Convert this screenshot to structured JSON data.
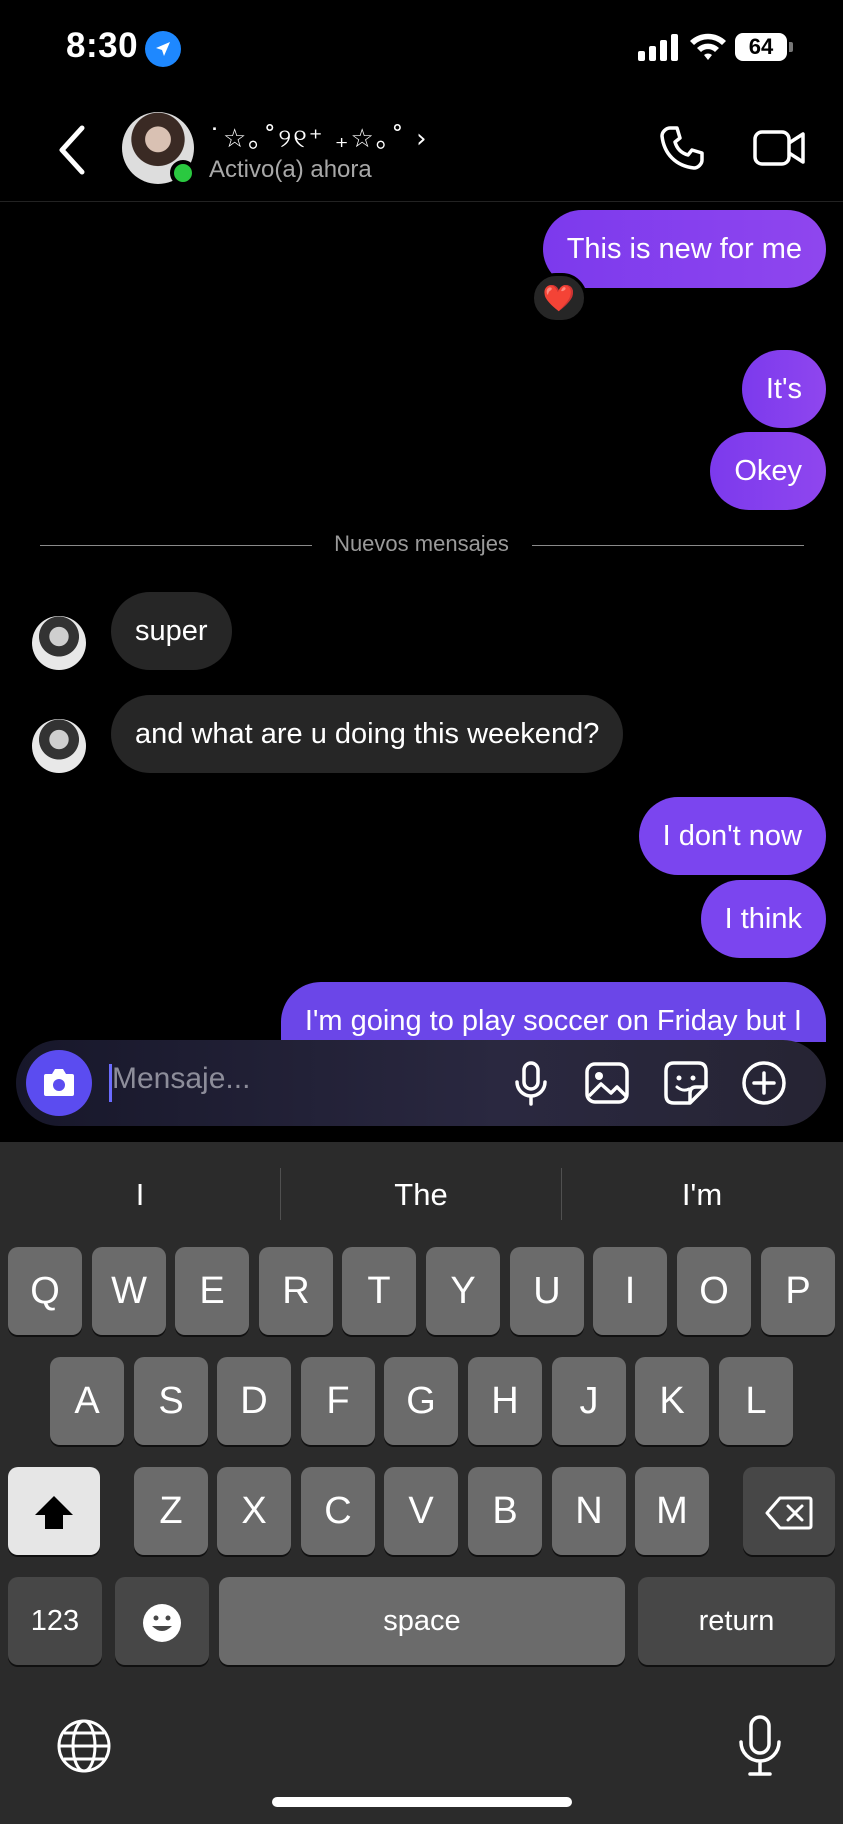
{
  "status_bar": {
    "time": "8:30",
    "battery": "64"
  },
  "header": {
    "contact_name": "˙☆｡˚୨୧⁺ ₊☆｡˚",
    "chevron": "›",
    "status": "Activo(a) ahora"
  },
  "messages": [
    {
      "dir": "out",
      "text": "This is new for me"
    },
    {
      "dir": "out",
      "text": "It's"
    },
    {
      "dir": "out",
      "text": "Okey"
    },
    {
      "dir": "in",
      "text": "super"
    },
    {
      "dir": "in",
      "text": "and what are u doing this weekend?"
    },
    {
      "dir": "out",
      "text": "I don't now"
    },
    {
      "dir": "out",
      "text": "I think"
    },
    {
      "dir": "out",
      "text": "I'm going to play soccer on Friday but I"
    }
  ],
  "reaction": "❤️",
  "divider_label": "Nuevos mensajes",
  "composer": {
    "placeholder": "Mensaje..."
  },
  "suggestions": [
    "I",
    "The",
    "I'm"
  ],
  "keyboard": {
    "row1": [
      "Q",
      "W",
      "E",
      "R",
      "T",
      "Y",
      "U",
      "I",
      "O",
      "P"
    ],
    "row2": [
      "A",
      "S",
      "D",
      "F",
      "G",
      "H",
      "J",
      "K",
      "L"
    ],
    "row3": [
      "Z",
      "X",
      "C",
      "V",
      "B",
      "N",
      "M"
    ],
    "numbers_label": "123",
    "space_label": "space",
    "return_label": "return"
  },
  "icons": {
    "back": "chevron-left-icon",
    "call": "phone-icon",
    "video": "video-camera-icon",
    "camera": "camera-icon",
    "mic": "microphone-icon",
    "gallery": "image-icon",
    "sticker": "sticker-icon",
    "plus": "plus-circle-icon",
    "globe": "globe-icon",
    "dictation": "microphone-icon"
  },
  "colors": {
    "accent_purple": "#7c3aed",
    "online": "#2ac940",
    "incoming_bubble": "#262626"
  }
}
